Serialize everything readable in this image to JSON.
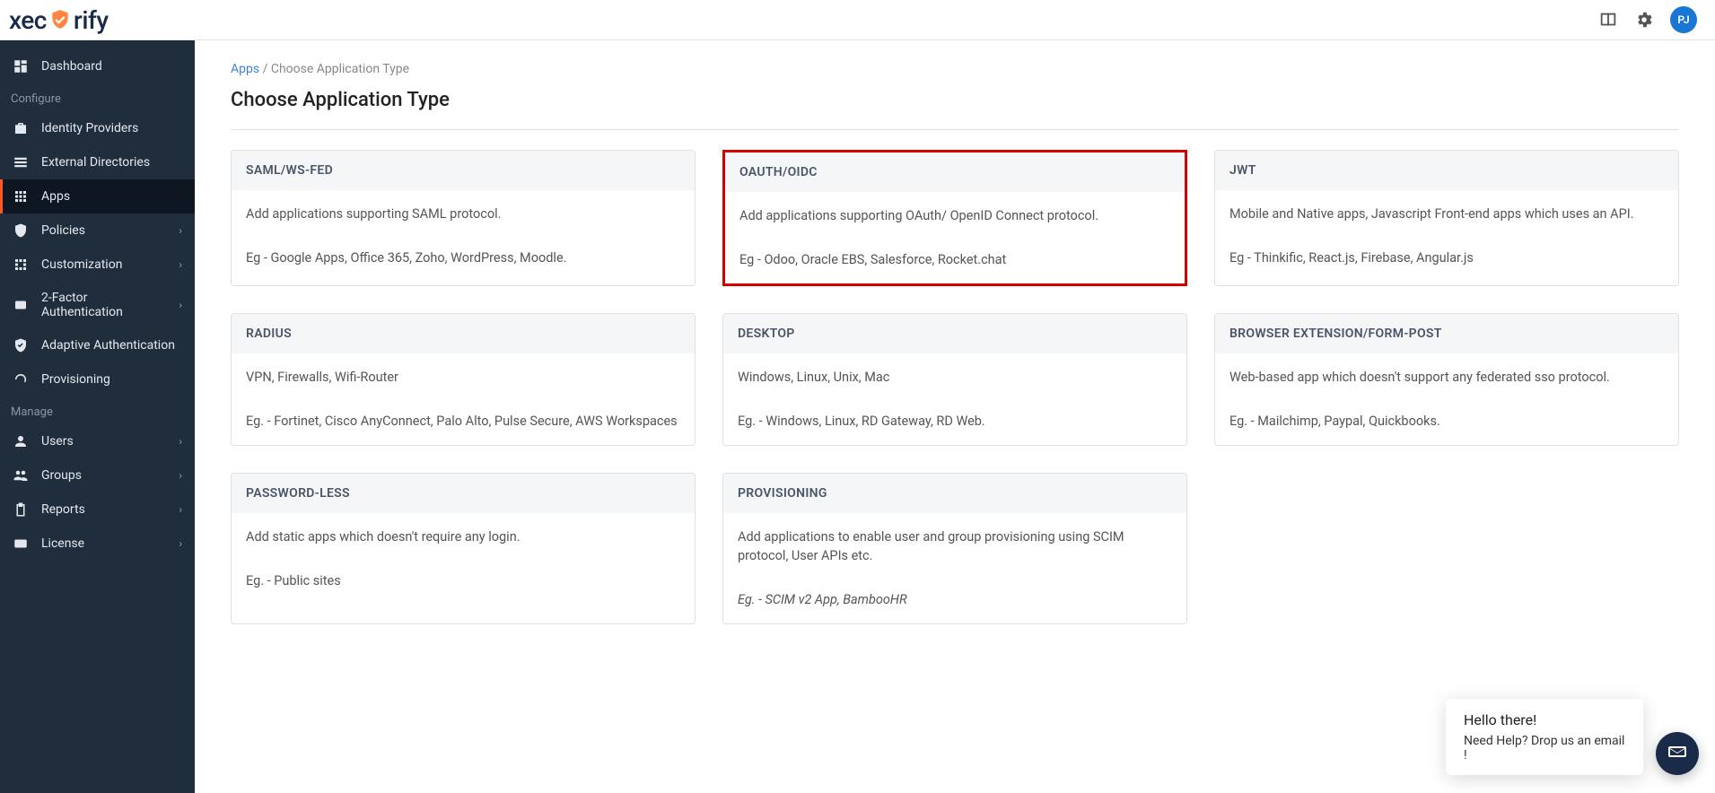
{
  "brand": {
    "name_pre": "xec",
    "name_post": "rify"
  },
  "topbar": {
    "avatar_initials": "PJ"
  },
  "sidebar": {
    "items": [
      {
        "label": "Dashboard"
      }
    ],
    "section_configure": "Configure",
    "configure": [
      {
        "label": "Identity Providers"
      },
      {
        "label": "External Directories"
      },
      {
        "label": "Apps",
        "active": true
      },
      {
        "label": "Policies",
        "expandable": true
      },
      {
        "label": "Customization",
        "expandable": true
      },
      {
        "label": "2-Factor Authentication",
        "expandable": true
      },
      {
        "label": "Adaptive Authentication"
      },
      {
        "label": "Provisioning"
      }
    ],
    "section_manage": "Manage",
    "manage": [
      {
        "label": "Users",
        "expandable": true
      },
      {
        "label": "Groups",
        "expandable": true
      },
      {
        "label": "Reports",
        "expandable": true
      },
      {
        "label": "License",
        "expandable": true
      }
    ]
  },
  "breadcrumb": {
    "root": "Apps",
    "sep": "/",
    "current": "Choose Application Type"
  },
  "page_title": "Choose Application Type",
  "cards": [
    {
      "title": "SAML/WS-FED",
      "desc": "Add applications supporting SAML protocol.",
      "eg": "Eg - Google Apps, Office 365, Zoho, WordPress, Moodle."
    },
    {
      "title": "OAUTH/OIDC",
      "desc": "Add applications supporting OAuth/ OpenID Connect protocol.",
      "eg": "Eg - Odoo, Oracle EBS, Salesforce, Rocket.chat",
      "highlight": true
    },
    {
      "title": "JWT",
      "desc": "Mobile and Native apps, Javascript Front-end apps which uses an API.",
      "eg": "Eg - Thinkific, React.js, Firebase, Angular.js"
    },
    {
      "title": "RADIUS",
      "desc": "VPN, Firewalls, Wifi-Router",
      "eg": "Eg. - Fortinet, Cisco AnyConnect, Palo Alto, Pulse Secure, AWS Workspaces"
    },
    {
      "title": "DESKTOP",
      "desc": "Windows, Linux, Unix, Mac",
      "eg": "Eg. - Windows, Linux, RD Gateway, RD Web."
    },
    {
      "title": "BROWSER EXTENSION/FORM-POST",
      "desc": "Web-based app which doesn't support any federated sso protocol.",
      "eg": "Eg. - Mailchimp, Paypal, Quickbooks."
    },
    {
      "title": "PASSWORD-LESS",
      "desc": "Add static apps which doesn't require any login.",
      "eg": "Eg. - Public sites"
    },
    {
      "title": "PROVISIONING",
      "desc": "Add applications to enable user and group provisioning using SCIM protocol, User APIs etc.",
      "eg": "Eg. - SCIM v2 App, BambooHR",
      "eg_italic": true
    }
  ],
  "chat": {
    "hello": "Hello there!",
    "need": "Need Help? Drop us an email !"
  }
}
